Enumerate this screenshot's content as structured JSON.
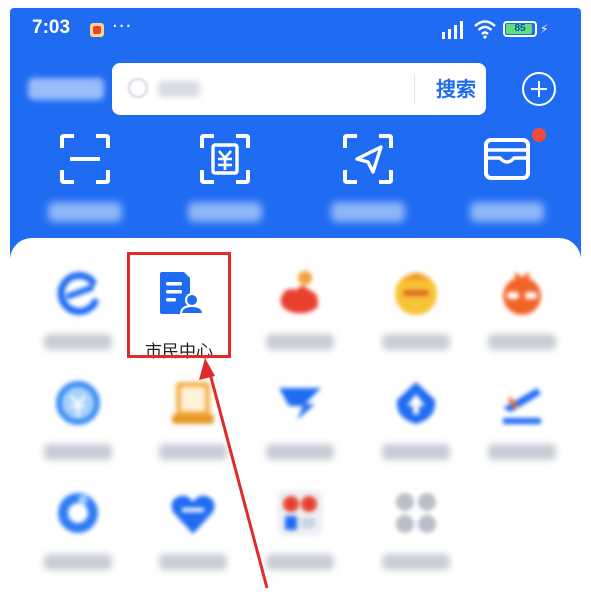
{
  "status_bar": {
    "time": "7:03",
    "more": "···",
    "battery": "85",
    "battery_level": 0.85,
    "icons": [
      "signal-icon",
      "wifi-icon",
      "battery-icon",
      "charging-icon"
    ]
  },
  "header": {
    "search_button_label": "搜索",
    "add_icon": "plus-circle-icon"
  },
  "quick_actions": [
    {
      "icon": "scan-icon"
    },
    {
      "icon": "payment-code-icon"
    },
    {
      "icon": "travel-icon"
    },
    {
      "icon": "wallet-icon",
      "badge": true
    }
  ],
  "apps": {
    "highlighted": {
      "label": "市民中心",
      "icon": "citizen-center-icon"
    },
    "others": [
      "blurred-app-icon",
      "blurred-app-icon",
      "blurred-app-icon",
      "blurred-app-icon",
      "blurred-app-icon",
      "blurred-app-icon",
      "blurred-app-icon",
      "blurred-app-icon",
      "blurred-app-icon",
      "blurred-app-icon",
      "blurred-app-icon",
      "blurred-app-icon",
      "blurred-app-icon",
      "more-apps-icon"
    ]
  },
  "colors": {
    "primary_blue": "#1f6cf2",
    "annotation_red": "#e12a2a",
    "badge_red": "#f24b3b"
  }
}
